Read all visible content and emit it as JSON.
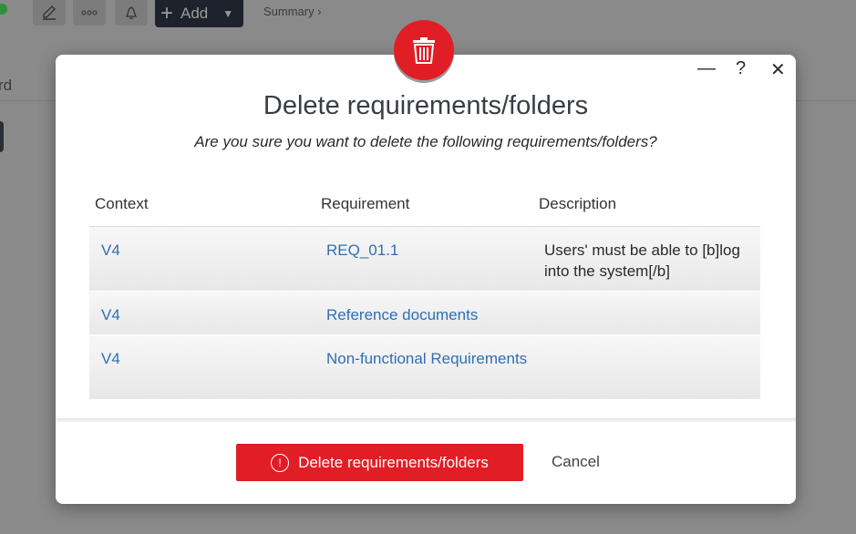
{
  "background": {
    "add_label": "Add",
    "breadcrumb": "Summary ›",
    "partial_label": "rd"
  },
  "dialog": {
    "title": "Delete requirements/folders",
    "subtitle": "Are you sure you want to delete the following requirements/folders?",
    "controls": {
      "minimize": "—",
      "help": "?",
      "close": "✕"
    },
    "columns": [
      "Context",
      "Requirement",
      "Description"
    ],
    "rows": [
      {
        "context": "V4",
        "requirement": "REQ_01.1",
        "description": "Users' must be able to [b]log into the system[/b]"
      },
      {
        "context": "V4",
        "requirement": "Reference documents",
        "description": ""
      },
      {
        "context": "V4",
        "requirement": "Non-functional Requirements",
        "description": ""
      }
    ],
    "delete_label": "Delete requirements/folders",
    "cancel_label": "Cancel"
  },
  "colors": {
    "danger": "#e11d25",
    "link": "#2f6fb4"
  },
  "icons": [
    "pencil-icon",
    "more-icon",
    "bell-icon",
    "plus-icon",
    "chevron-down-icon",
    "trash-icon",
    "alert-circle-icon"
  ]
}
